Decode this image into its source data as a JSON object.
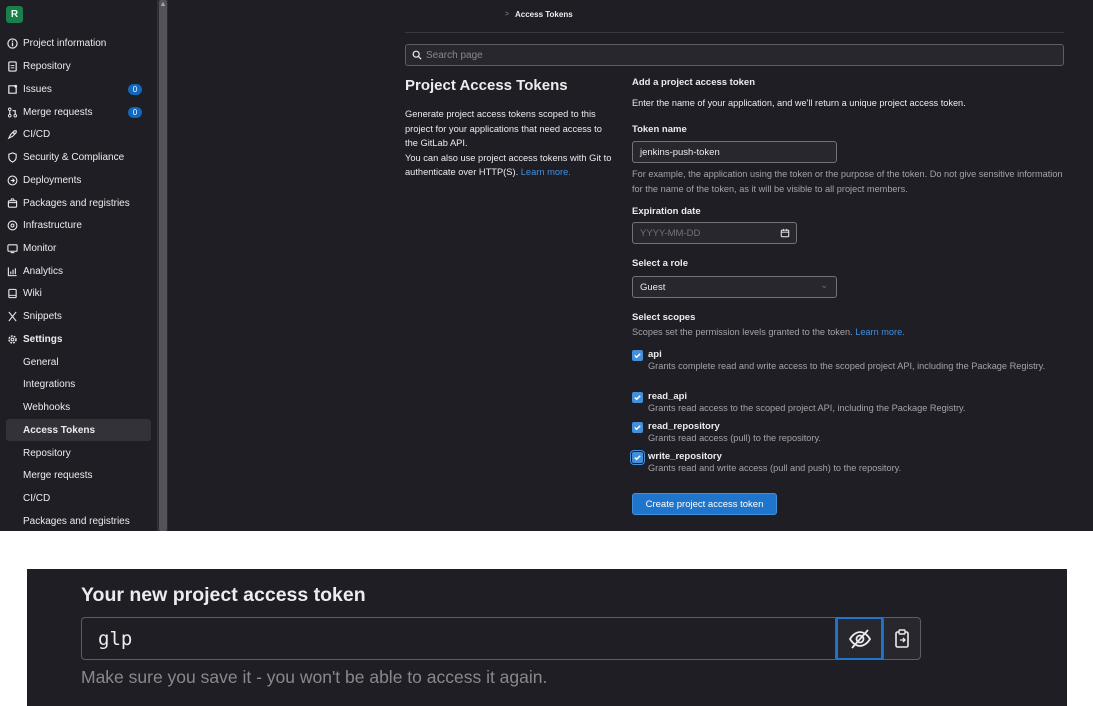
{
  "sidebar": {
    "avatar_letter": "R",
    "items": [
      {
        "label": "Project information",
        "icon": "info-icon"
      },
      {
        "label": "Repository",
        "icon": "document-icon"
      },
      {
        "label": "Issues",
        "icon": "issues-icon",
        "badge": "0"
      },
      {
        "label": "Merge requests",
        "icon": "merge-request-icon",
        "badge": "0"
      },
      {
        "label": "CI/CD",
        "icon": "rocket-icon"
      },
      {
        "label": "Security & Compliance",
        "icon": "shield-icon"
      },
      {
        "label": "Deployments",
        "icon": "deployments-icon"
      },
      {
        "label": "Packages and registries",
        "icon": "package-icon"
      },
      {
        "label": "Infrastructure",
        "icon": "cloud-icon"
      },
      {
        "label": "Monitor",
        "icon": "monitor-icon"
      },
      {
        "label": "Analytics",
        "icon": "chart-icon"
      },
      {
        "label": "Wiki",
        "icon": "book-icon"
      },
      {
        "label": "Snippets",
        "icon": "snippet-icon"
      },
      {
        "label": "Settings",
        "icon": "gear-icon"
      }
    ],
    "settings_items": [
      "General",
      "Integrations",
      "Webhooks",
      "Access Tokens",
      "Repository",
      "Merge requests",
      "CI/CD",
      "Packages and registries"
    ],
    "active_settings_item": "Access Tokens"
  },
  "breadcrumb": {
    "separator": ">",
    "current": "Access Tokens"
  },
  "search": {
    "placeholder": "Search page"
  },
  "intro": {
    "title": "Project Access Tokens",
    "description": "Generate project access tokens scoped to this project for your applications that need access to the GitLab API.",
    "description2": "You can also use project access tokens with Git to authenticate over HTTP(S).",
    "learn_more": "Learn more."
  },
  "form": {
    "heading": "Add a project access token",
    "subheading": "Enter the name of your application, and we'll return a unique project access token.",
    "token_name_label": "Token name",
    "token_name_value": "jenkins-push-token",
    "token_name_help": "For example, the application using the token or the purpose of the token. Do not give sensitive information for the name of the token, as it will be visible to all project members.",
    "expiration_label": "Expiration date",
    "expiration_placeholder": "YYYY-MM-DD",
    "role_label": "Select a role",
    "role_value": "Guest",
    "scopes_label": "Select scopes",
    "scopes_help": "Scopes set the permission levels granted to the token.",
    "scopes_learn_more": "Learn more.",
    "scopes": [
      {
        "name": "api",
        "description": "Grants complete read and write access to the scoped project API, including the Package Registry.",
        "checked": true
      },
      {
        "name": "read_api",
        "description": "Grants read access to the scoped project API, including the Package Registry.",
        "checked": true
      },
      {
        "name": "read_repository",
        "description": "Grants read access (pull) to the repository.",
        "checked": true
      },
      {
        "name": "write_repository",
        "description": "Grants read and write access (pull and push) to the repository.",
        "checked": true
      }
    ],
    "submit_label": "Create project access token"
  },
  "new_token": {
    "title": "Your new project access token",
    "value": "glp",
    "note": "Make sure you save it - you won't be able to access it again.",
    "toggle_icon": "eye-slash-icon",
    "copy_icon": "clipboard-icon"
  },
  "colors": {
    "accent": "#1f75cb",
    "link": "#428fdc",
    "background": "#1f1e24",
    "success": "#1a7f4b"
  }
}
